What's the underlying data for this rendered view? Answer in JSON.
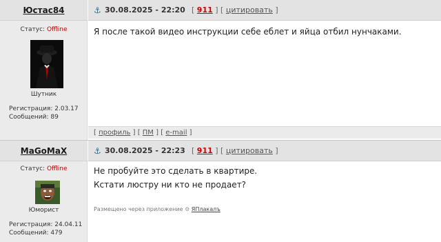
{
  "posts": [
    {
      "username": "Юстас84",
      "date": "30.08.2025 - 22:20",
      "post_number": "911",
      "quote_label": "цитировать",
      "status_label": "Статус:",
      "status_value": "Offline",
      "rank": "Шутник",
      "registration_label": "Регистрация:",
      "registration_date": "2.03.17",
      "messages_label": "Сообщений:",
      "messages_count": "89",
      "text_lines": [
        "Я после такой видео инструкции себе еблет и яйца отбил нунчаками."
      ],
      "footer": {
        "profile": "профиль",
        "pm": "ПМ",
        "email": "e-mail"
      }
    },
    {
      "username": "MaGoMaX",
      "date": "30.08.2025 - 22:23",
      "post_number": "911",
      "quote_label": "цитировать",
      "status_label": "Статус:",
      "status_value": "Offline",
      "rank": "Юморист",
      "registration_label": "Регистрация:",
      "registration_date": "24.04.11",
      "messages_label": "Сообщений:",
      "messages_count": "479",
      "text_lines": [
        "Не пробуйте это сделать в квартире.",
        "Кстати люстру ни кто не продает?"
      ],
      "posted_via": "Размещено через приложение",
      "app_name": "ЯПлакалъ"
    }
  ],
  "icons": {
    "anchor": "anchor-icon",
    "app": "gear-icon"
  },
  "colors": {
    "header_bg": "#e3e3e3",
    "offline": "#c00000",
    "post_number": "#d00000",
    "anchor": "#1b6f9c"
  }
}
